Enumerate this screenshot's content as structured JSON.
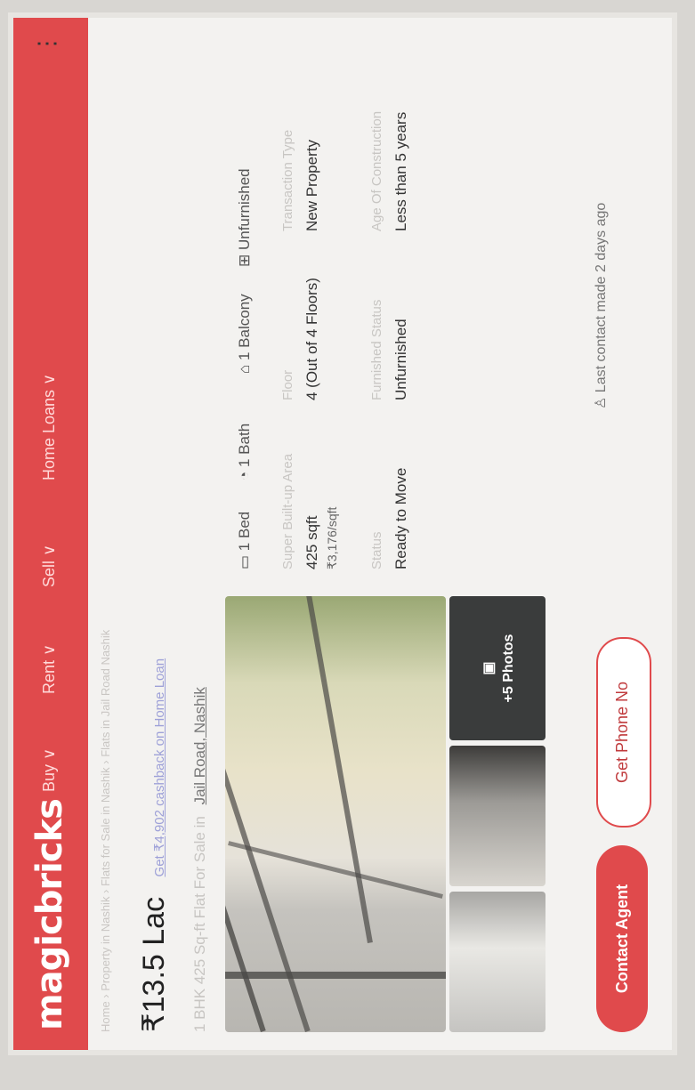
{
  "header": {
    "logo": "magicbricks",
    "nav": [
      "Buy ∨",
      "Rent ∨",
      "Sell ∨",
      "Home Loans ∨"
    ],
    "menu_icon": "⋮"
  },
  "listing": {
    "breadcrumb": "Home › Property in Nashik › Flats for Sale in Nashik › Flats in Jail Road Nashik",
    "price": "₹13.5 Lac",
    "emi_link": "Get ₹4,902 cashback on Home Loan",
    "title_prefix": "1 BHK 425 Sq-ft Flat For Sale in",
    "location": "Jail Road, Nashik",
    "photos_more": "+5 Photos",
    "specs_icons": [
      "1 Bed",
      "1 Bath",
      "1 Balcony",
      "Unfurnished"
    ],
    "specs": [
      {
        "label": "Super Built-up Area",
        "value": "425 sqft"
      },
      {
        "label": "Floor",
        "value": "4 (Out of 4 Floors)"
      },
      {
        "label": "Transaction Type",
        "value": "New Property"
      },
      {
        "label": "Status",
        "value": "Ready to Move"
      },
      {
        "label": "Furnished Status",
        "value": "Unfurnished"
      },
      {
        "label": "Age Of Construction",
        "value": "Less than 5 years"
      }
    ],
    "price_per_sqft": "₹3,176/sqft",
    "last_contact": "Last contact made 2 days ago"
  },
  "actions": {
    "contact_agent": "Contact Agent",
    "get_phone": "Get Phone No"
  },
  "colors": {
    "brand": "#e04a4c"
  }
}
